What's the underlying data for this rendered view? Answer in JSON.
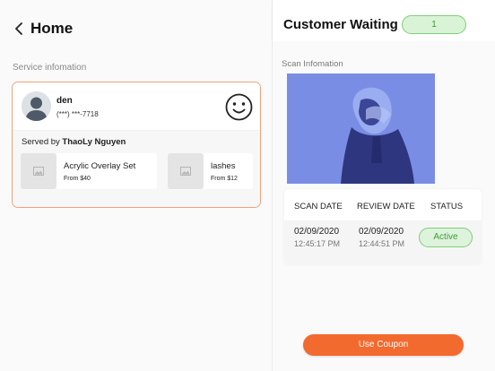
{
  "header": {
    "back_label": "Home"
  },
  "service_info": {
    "section_label": "Service infomation",
    "customer": {
      "name": "den",
      "phone": "(***) ***-7718"
    },
    "served_by_prefix": "Served by ",
    "served_by_name": "ThaoLy Nguyen",
    "services": [
      {
        "name": "Acrylic Overlay Set",
        "price": "From $40"
      },
      {
        "name": "lashes",
        "price": "From $12"
      }
    ]
  },
  "customer_waiting": {
    "title": "Customer Waiting",
    "count": "1"
  },
  "scan": {
    "section_label": "Scan Infomation",
    "columns": [
      "SCAN DATE",
      "REVIEW DATE",
      "STATUS"
    ],
    "row": {
      "scan_date": "02/09/2020",
      "scan_time": "12:45:17 PM",
      "review_date": "02/09/2020",
      "review_time": "12:44:51 PM",
      "status": "Active"
    }
  },
  "actions": {
    "use_coupon": "Use Coupon"
  },
  "colors": {
    "accent": "#f26a2e",
    "card_border": "#f2a27a",
    "success_bg": "#d9f3d6",
    "success_text": "#3f9a38",
    "scan_tint": "#7e92e9"
  },
  "icons": [
    "chevron-left-icon",
    "avatar-icon",
    "smiley-icon",
    "image-placeholder-icon"
  ]
}
